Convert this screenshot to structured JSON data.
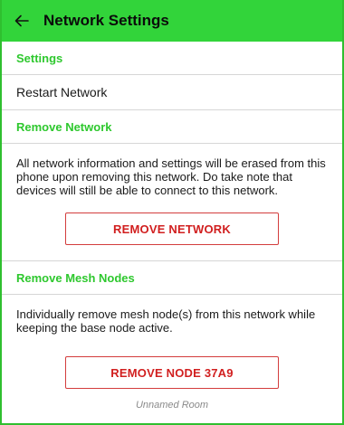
{
  "app_bar": {
    "back_icon": "arrow-left-icon",
    "title": "Network Settings"
  },
  "settings_section": {
    "header": "Settings",
    "items": [
      {
        "label": "Restart Network"
      }
    ]
  },
  "remove_network_section": {
    "header": "Remove Network",
    "description": "All network information and settings will be erased from this phone upon removing this network. Do take note that devices will still be able to connect to this network.",
    "button_label": "REMOVE NETWORK"
  },
  "remove_mesh_section": {
    "header": "Remove Mesh Nodes",
    "description": "Individually remove mesh node(s) from this network while keeping the base node active.",
    "nodes": [
      {
        "button_label": "REMOVE NODE 37A9",
        "room": "Unnamed Room"
      }
    ]
  },
  "colors": {
    "app_bar": "#32d43a",
    "section_header": "#2ec82e",
    "danger": "#d11f1f"
  }
}
